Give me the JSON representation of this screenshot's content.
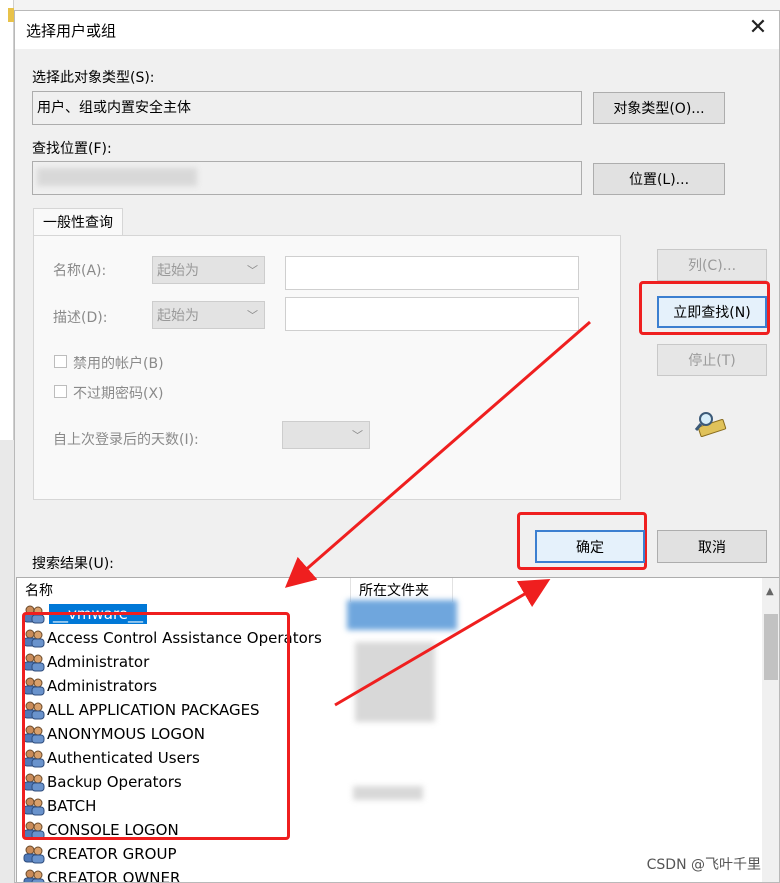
{
  "dialog": {
    "title": "选择用户或组",
    "close_glyph": "✕"
  },
  "object_type": {
    "label": "选择此对象类型(S):",
    "value": "用户、组或内置安全主体",
    "button": "对象类型(O)..."
  },
  "location": {
    "label": "查找位置(F):",
    "value": "",
    "button": "位置(L)..."
  },
  "query": {
    "tab": "一般性查询",
    "name_label": "名称(A):",
    "name_mode": "起始为",
    "desc_label": "描述(D):",
    "desc_mode": "起始为",
    "disabled_accounts": "禁用的帐户(B)",
    "non_expiring_password": "不过期密码(X)",
    "days_since_logon": "自上次登录后的天数(I):"
  },
  "side_buttons": {
    "columns": "列(C)...",
    "find_now": "立即查找(N)",
    "stop": "停止(T)"
  },
  "actions": {
    "ok": "确定",
    "cancel": "取消"
  },
  "results": {
    "label": "搜索结果(U):",
    "columns": [
      "名称",
      "所在文件夹"
    ],
    "rows": [
      {
        "name": "__vmware__",
        "selected": true
      },
      {
        "name": "Access Control Assistance Operators",
        "selected": false
      },
      {
        "name": "Administrator",
        "selected": false
      },
      {
        "name": "Administrators",
        "selected": false
      },
      {
        "name": "ALL APPLICATION PACKAGES",
        "selected": false
      },
      {
        "name": "ANONYMOUS LOGON",
        "selected": false
      },
      {
        "name": "Authenticated Users",
        "selected": false
      },
      {
        "name": "Backup Operators",
        "selected": false
      },
      {
        "name": "BATCH",
        "selected": false
      },
      {
        "name": "CONSOLE LOGON",
        "selected": false
      },
      {
        "name": "CREATOR GROUP",
        "selected": false
      },
      {
        "name": "CREATOR OWNER",
        "selected": false
      }
    ]
  },
  "watermark": "CSDN @飞叶千里",
  "colors": {
    "selection": "#0078d7",
    "annotation_red": "#ef1f1f"
  }
}
